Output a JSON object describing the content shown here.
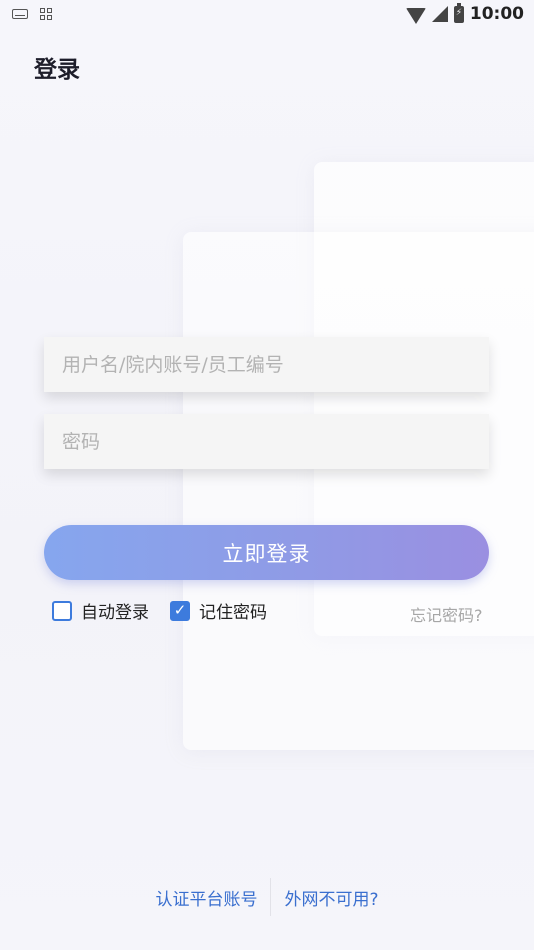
{
  "status_bar": {
    "time": "10:00",
    "left_icons": [
      "keyboard-icon",
      "app-grid-icon"
    ],
    "right_icons": [
      "wifi-icon",
      "signal-icon",
      "battery-charging-icon"
    ]
  },
  "page": {
    "title": "登录"
  },
  "form": {
    "username": {
      "placeholder": "用户名/院内账号/员工编号",
      "value": ""
    },
    "password": {
      "placeholder": "密码",
      "value": ""
    },
    "login_button": "立即登录",
    "auto_login": {
      "label": "自动登录",
      "checked": false
    },
    "remember_password": {
      "label": "记住密码",
      "checked": true
    },
    "forgot_password": "忘记密码?"
  },
  "footer": {
    "auth_platform": "认证平台账号",
    "network_unavailable": "外网不可用?"
  },
  "colors": {
    "accent": "#3d7bdd",
    "link": "#3a6fcf",
    "button_gradient_start": "#86a6ee",
    "button_gradient_end": "#9a8fe1"
  }
}
